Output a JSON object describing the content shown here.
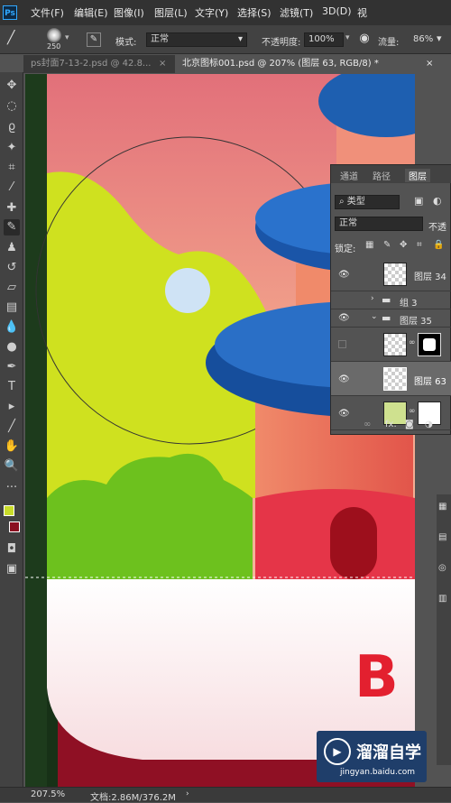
{
  "app": {
    "logo": "Ps"
  },
  "menu": [
    "文件(F)",
    "编辑(E)",
    "图像(I)",
    "图层(L)",
    "文字(Y)",
    "选择(S)",
    "滤镜(T)",
    "3D(D)",
    "视"
  ],
  "options": {
    "brush_size": "250",
    "mode_label": "模式:",
    "mode_value": "正常",
    "opacity_label": "不透明度:",
    "opacity_value": "100%",
    "flow_label": "流量:",
    "flow_value": "86%"
  },
  "tabs": [
    {
      "label": "ps封面7-13-2.psd @ 42.8..."
    },
    {
      "label": "北京图标001.psd @ 207% (图层 63, RGB/8) *"
    }
  ],
  "layers_panel": {
    "tabs": [
      "通道",
      "路径",
      "图层"
    ],
    "filter_label": "类型",
    "blend_mode": "正常",
    "opacity_cut": "不透",
    "lock_label": "锁定:",
    "layers": [
      {
        "name": "图层 34"
      },
      {
        "name": "组 3"
      },
      {
        "name": "图层 35"
      },
      {
        "name": ""
      },
      {
        "name": "图层 63"
      },
      {
        "name": ""
      }
    ],
    "footer_icons": [
      "link-icon",
      "fx-icon",
      "mask-icon",
      "adjustment-icon"
    ],
    "fx_text": "fx."
  },
  "canvas_art": {
    "letter": "B"
  },
  "status": {
    "zoom": "207.5%",
    "doc": "文档:2.86M/376.2M"
  },
  "watermark": {
    "title": "溜溜自学",
    "url": "jingyan.baidu.com"
  },
  "colors": {
    "foreground": "#c9dc2a",
    "background": "#8a1020",
    "accent_blue": "#1e5fb0",
    "sky_pink": "#e8847a"
  }
}
